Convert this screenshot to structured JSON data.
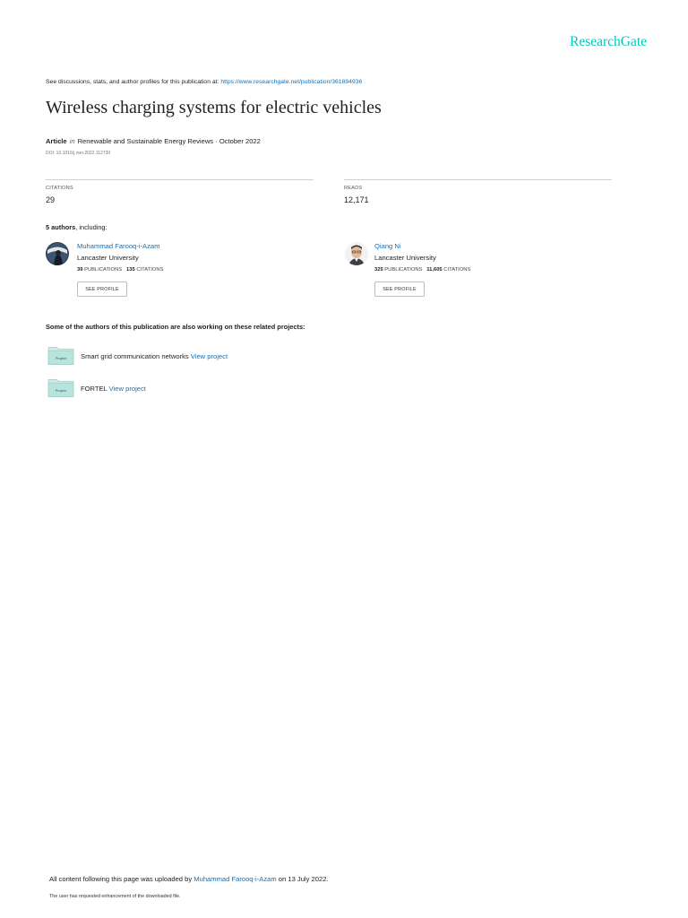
{
  "header": {
    "logo_text": "ResearchGate"
  },
  "discussion": {
    "prefix": "See discussions, stats, and author profiles for this publication at: ",
    "url": "https://www.researchgate.net/publication/361894936"
  },
  "publication": {
    "title": "Wireless charging systems for electric vehicles",
    "type": "Article",
    "in_label": "in",
    "venue": "Renewable and Sustainable Energy Reviews · October 2022",
    "doi": "DOI: 10.1016/j.rser.2022.112730"
  },
  "stats": {
    "citations_label": "CITATIONS",
    "citations_value": "29",
    "reads_label": "READS",
    "reads_value": "12,171"
  },
  "authors_section": {
    "count_text": "5 authors",
    "suffix": ", including:",
    "authors": [
      {
        "name": "Muhammad Farooq-i-Azam",
        "institution": "Lancaster University",
        "publications": "39",
        "publications_label": "PUBLICATIONS",
        "citations": "135",
        "citations_label": "CITATIONS",
        "button_label": "SEE PROFILE"
      },
      {
        "name": "Qiang Ni",
        "institution": "Lancaster University",
        "publications": "325",
        "publications_label": "PUBLICATIONS",
        "citations": "11,605",
        "citations_label": "CITATIONS",
        "button_label": "SEE PROFILE"
      }
    ]
  },
  "projects_section": {
    "heading": "Some of the authors of this publication are also working on these related projects:",
    "projects": [
      {
        "icon_label": "Project",
        "name": "Smart grid communication networks",
        "link": "View project"
      },
      {
        "icon_label": "Project",
        "name": "FORTEL",
        "link": "View project"
      }
    ]
  },
  "footer": {
    "upload_prefix": "All content following this page was uploaded by ",
    "uploader": "Muhammad Farooq-i-Azam",
    "upload_suffix": " on 13 July 2022.",
    "note": "The user has requested enhancement of the downloaded file."
  },
  "colors": {
    "brand": "#00c8b4",
    "link": "#1a6fb0",
    "project_folder": "#b9e3dd"
  },
  "icons": {
    "avatar_1": "avatar-photo",
    "avatar_2": "avatar-photo",
    "project": "folder-icon"
  }
}
